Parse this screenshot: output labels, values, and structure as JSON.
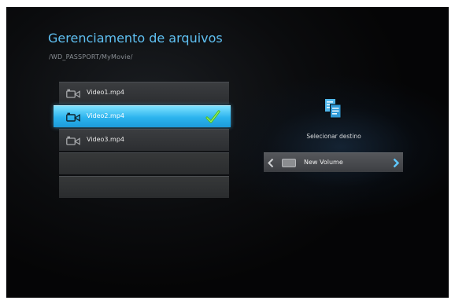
{
  "header": {
    "title": "Gerenciamento de arquivos",
    "path": "/WD_PASSPORT/MyMovie/"
  },
  "files": [
    {
      "name": "Video1.mp4",
      "selected": false,
      "icon": "video-camera-icon"
    },
    {
      "name": "Video2.mp4",
      "selected": true,
      "icon": "video-camera-icon",
      "checked": true
    },
    {
      "name": "Video3.mp4",
      "selected": false,
      "icon": "video-camera-icon"
    }
  ],
  "destination": {
    "icon": "copy-documents-icon",
    "label": "Selecionar destino",
    "volume": "New Volume",
    "volume_icon": "drive-icon"
  },
  "colors": {
    "accent": "#5fc0f2",
    "selected_row": "#2bb3ee",
    "check": "#5fd12a",
    "background": "#0b0c0e"
  }
}
